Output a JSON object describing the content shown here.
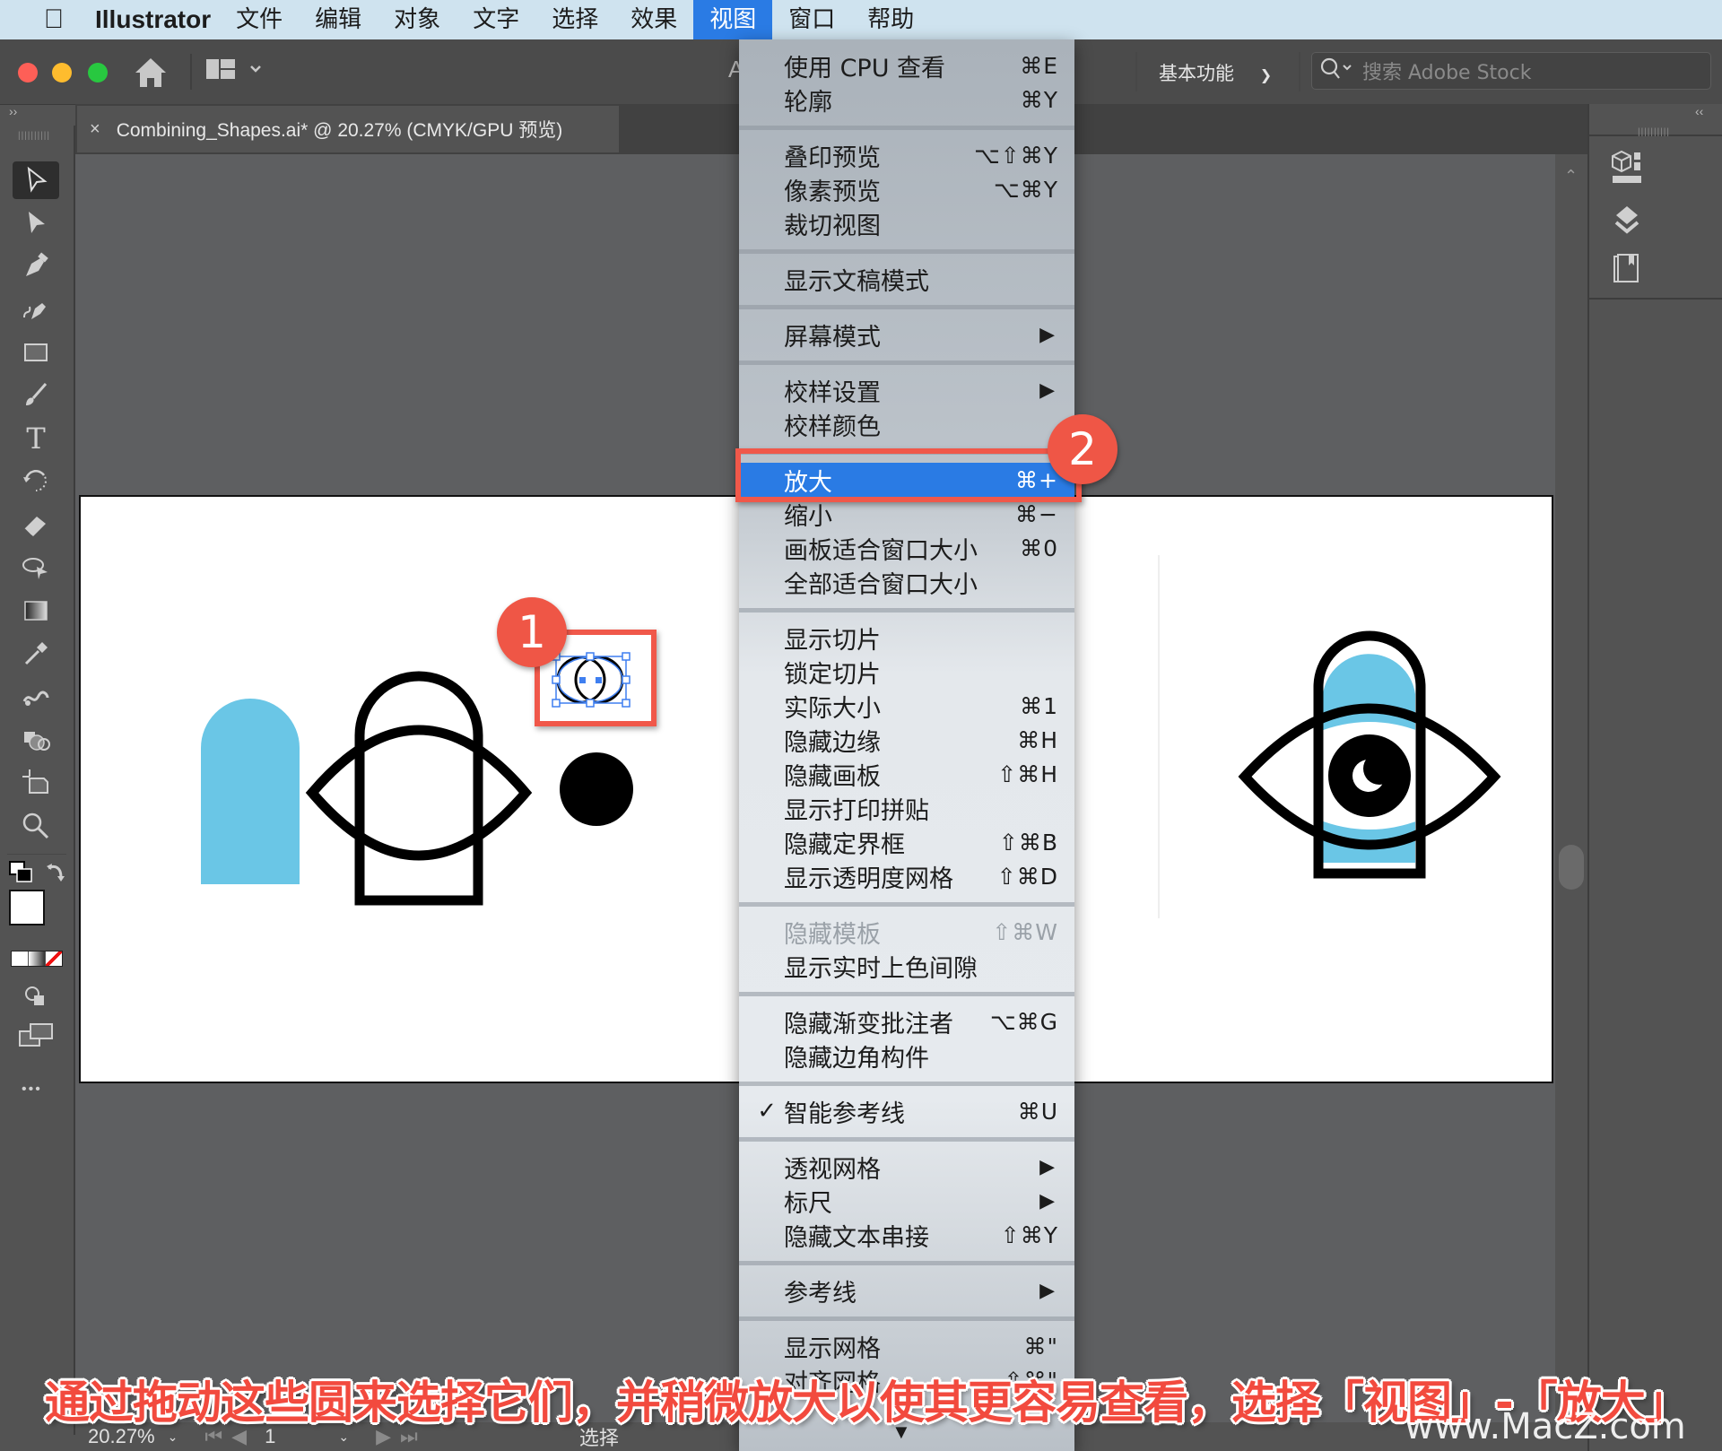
{
  "menubar": {
    "apple_icon": "apple-logo-icon",
    "app_name": "Illustrator",
    "items": [
      "文件",
      "编辑",
      "对象",
      "文字",
      "选择",
      "效果",
      "视图",
      "窗口",
      "帮助"
    ],
    "active_index": 6
  },
  "titlebar": {
    "home_icon": "home-icon",
    "layout_icon": "layout-grid-icon",
    "truncated_title_char": "A",
    "workspace_label": "基本功能",
    "search_placeholder": "搜索 Adobe Stock"
  },
  "document": {
    "tab_title": "Combining_Shapes.ai* @ 20.27% (CMYK/GPU 预览)",
    "close_glyph": "×"
  },
  "left_collapse": "››",
  "right_collapse": "‹‹",
  "toolbar": {
    "tools": [
      {
        "name": "selection-tool-icon"
      },
      {
        "name": "direct-selection-tool-icon"
      },
      {
        "name": "pen-tool-icon"
      },
      {
        "name": "curvature-tool-icon"
      },
      {
        "name": "rectangle-tool-icon"
      },
      {
        "name": "paintbrush-tool-icon"
      },
      {
        "name": "type-tool-icon",
        "glyph": "T"
      },
      {
        "name": "rotate-tool-icon"
      },
      {
        "name": "eraser-tool-icon"
      },
      {
        "name": "puppet-warp-tool-icon"
      },
      {
        "name": "gradient-tool-icon"
      },
      {
        "name": "eyedropper-tool-icon"
      },
      {
        "name": "blend-tool-icon"
      },
      {
        "name": "shape-builder-tool-icon"
      },
      {
        "name": "artboard-tool-icon"
      },
      {
        "name": "zoom-tool-icon"
      }
    ],
    "more_glyph": "•••"
  },
  "right_panel": {
    "icons": [
      "libraries-icon",
      "layers-icon",
      "asset-export-icon"
    ]
  },
  "colors": {
    "menu_highlight": "#2a7be4",
    "annotation_red": "#ef5646",
    "artwork_blue": "#6ac6e6"
  },
  "view_menu": {
    "items": [
      {
        "label": "使用 CPU 查看",
        "shortcut": "⌘E"
      },
      {
        "label": "轮廓",
        "shortcut": "⌘Y"
      },
      {
        "separator": true
      },
      {
        "label": "叠印预览",
        "shortcut": "⌥⇧⌘Y"
      },
      {
        "label": "像素预览",
        "shortcut": "⌥⌘Y"
      },
      {
        "label": "裁切视图",
        "shortcut": ""
      },
      {
        "separator": true
      },
      {
        "label": "显示文稿模式",
        "shortcut": ""
      },
      {
        "separator": true
      },
      {
        "label": "屏幕模式",
        "submenu": true
      },
      {
        "separator": true
      },
      {
        "label": "校样设置",
        "submenu": true
      },
      {
        "label": "校样颜色",
        "shortcut": ""
      },
      {
        "separator": true
      },
      {
        "label": "放大",
        "shortcut": "⌘+",
        "highlighted": true
      },
      {
        "label": "缩小",
        "shortcut": "⌘−"
      },
      {
        "label": "画板适合窗口大小",
        "shortcut": "⌘0"
      },
      {
        "label": "全部适合窗口大小",
        "shortcut": ""
      },
      {
        "separator": true
      },
      {
        "label": "显示切片",
        "shortcut": ""
      },
      {
        "label": "锁定切片",
        "shortcut": ""
      },
      {
        "label": "实际大小",
        "shortcut": "⌘1"
      },
      {
        "label": "隐藏边缘",
        "shortcut": "⌘H"
      },
      {
        "label": "隐藏画板",
        "shortcut": "⇧⌘H"
      },
      {
        "label": "显示打印拼贴",
        "shortcut": ""
      },
      {
        "label": "隐藏定界框",
        "shortcut": "⇧⌘B"
      },
      {
        "label": "显示透明度网格",
        "shortcut": "⇧⌘D"
      },
      {
        "separator": true
      },
      {
        "label": "隐藏模板",
        "shortcut": "⇧⌘W",
        "disabled": true
      },
      {
        "label": "显示实时上色间隙",
        "shortcut": ""
      },
      {
        "separator": true
      },
      {
        "label": "隐藏渐变批注者",
        "shortcut": "⌥⌘G"
      },
      {
        "label": "隐藏边角构件",
        "shortcut": ""
      },
      {
        "separator": true
      },
      {
        "label": "智能参考线",
        "shortcut": "⌘U",
        "checked": true
      },
      {
        "separator": true
      },
      {
        "label": "透视网格",
        "submenu": true
      },
      {
        "label": "标尺",
        "submenu": true
      },
      {
        "label": "隐藏文本串接",
        "shortcut": "⇧⌘Y"
      },
      {
        "separator": true
      },
      {
        "label": "参考线",
        "submenu": true
      },
      {
        "separator": true
      },
      {
        "label": "显示网格",
        "shortcut": "⌘\""
      },
      {
        "label": "对齐网格",
        "shortcut": "⇧⌘\""
      }
    ],
    "scroll_down_glyph": "▼",
    "check_glyph": "✓",
    "submenu_glyph": "▶"
  },
  "annotations": {
    "step1": "1",
    "step2": "2",
    "caption": "通过拖动这些圆来选择它们，并稍微放大以使其更容易查看，选择「视图」-「放大」",
    "watermark": "www.MacZ.com"
  },
  "statusbar": {
    "zoom": "20.27%",
    "artboard_number": "1",
    "tool_name": "选择"
  }
}
